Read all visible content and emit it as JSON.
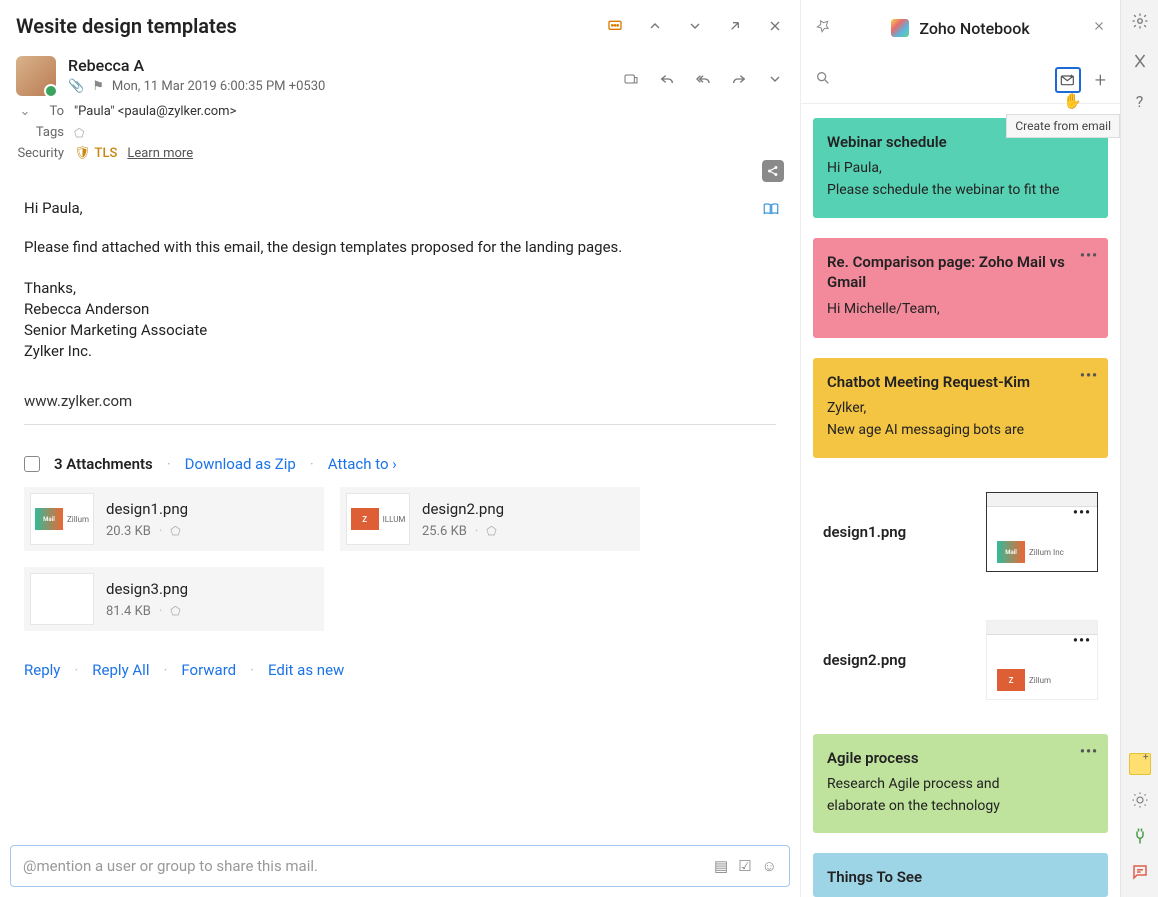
{
  "email": {
    "subject": "Wesite design templates",
    "sender_name": "Rebecca A",
    "date": "Mon, 11 Mar 2019 6:00:35 PM +0530",
    "to_label": "To",
    "to_value": "\"Paula\" <paula@zylker.com>",
    "tags_label": "Tags",
    "security_label": "Security",
    "tls_label": "TLS",
    "learn_more": "Learn more",
    "body_greeting": "Hi Paula,",
    "body_main": "Please find attached with this email, the design templates proposed for the landing pages.",
    "sig_thanks": "Thanks,",
    "sig_name": "Rebecca Anderson",
    "sig_title": "Senior Marketing Associate",
    "sig_company": "Zylker Inc.",
    "website": "www.zylker.com",
    "attachments_count": "3 Attachments",
    "download_zip": "Download as Zip",
    "attach_to": "Attach to ›",
    "attachments": [
      {
        "name": "design1.png",
        "size": "20.3 KB"
      },
      {
        "name": "design2.png",
        "size": "25.6 KB"
      },
      {
        "name": "design3.png",
        "size": "81.4 KB"
      }
    ],
    "actions": {
      "reply": "Reply",
      "reply_all": "Reply All",
      "forward": "Forward",
      "edit_as_new": "Edit as new"
    },
    "mention_placeholder": "@mention a user or group to share this mail."
  },
  "notebook": {
    "title": "Zoho Notebook",
    "tooltip": "Create from email",
    "notes": [
      {
        "title": "Webinar schedule",
        "line1": "Hi Paula,",
        "line2": "Please schedule the webinar to fit the"
      },
      {
        "title": "Re. Comparison page: Zoho Mail vs Gmail",
        "line1": "Hi Michelle/Team,"
      },
      {
        "title": "Chatbot Meeting Request-Kim",
        "line1": "Zylker,",
        "line2": "New age AI messaging bots are"
      },
      {
        "title": "design1.png"
      },
      {
        "title": "design2.png"
      },
      {
        "title": "Agile process",
        "line1": "Research Agile process and",
        "line2": "elaborate on the technology"
      },
      {
        "title": "Things To See"
      }
    ]
  }
}
